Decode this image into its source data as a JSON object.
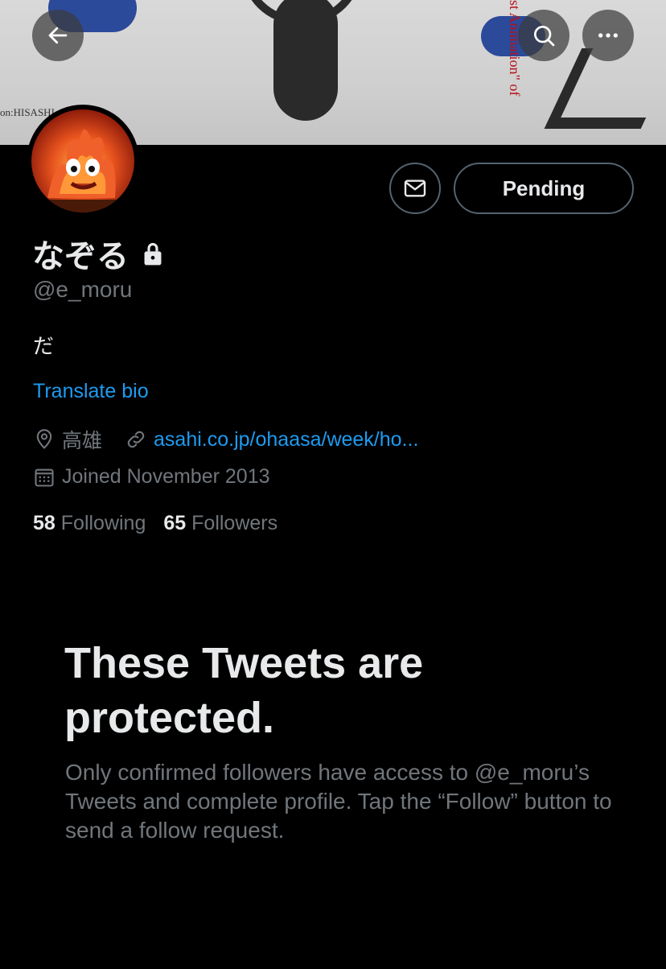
{
  "banner": {
    "credit_text": "on:HISASHI",
    "side_text": "st Animation\" of"
  },
  "header": {
    "back_icon": "arrow-left-icon",
    "search_icon": "search-icon",
    "more_icon": "more-horizontal-icon"
  },
  "actions": {
    "message_icon": "envelope-icon",
    "pending_label": "Pending"
  },
  "profile": {
    "display_name": "なぞる",
    "lock_icon": "lock-icon",
    "handle": "@e_moru",
    "bio": "だ",
    "translate_label": "Translate bio",
    "location": "高雄",
    "website": "asahi.co.jp/ohaasa/week/ho...",
    "joined": "Joined November 2013",
    "following_count": "58",
    "following_label": "Following",
    "followers_count": "65",
    "followers_label": "Followers"
  },
  "protected": {
    "title": "These Tweets are protected.",
    "description": "Only confirmed followers have access to @e_moru’s Tweets and complete profile. Tap the “Follow” button to send a follow request."
  },
  "colors": {
    "background": "#000000",
    "accent": "#1d9bf0",
    "secondary_text": "#71767b",
    "primary_text": "#e7e9ea"
  }
}
